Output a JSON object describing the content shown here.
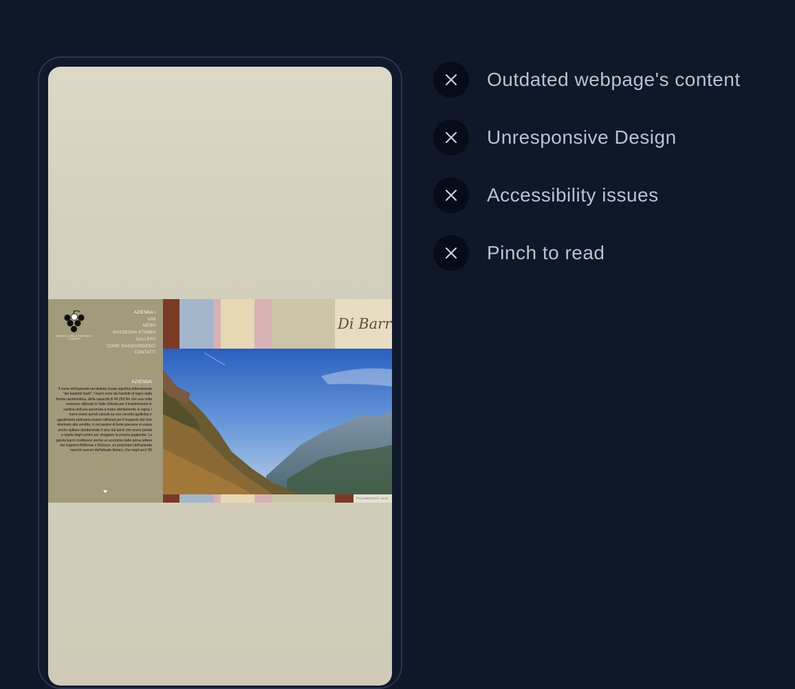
{
  "issues": [
    {
      "label": "Outdated webpage's content",
      "icon": "close-icon"
    },
    {
      "label": "Unresponsive Design",
      "icon": "close-icon"
    },
    {
      "label": "Accessibility issues",
      "icon": "close-icon"
    },
    {
      "label": "Pinch to read",
      "icon": "close-icon"
    }
  ],
  "site": {
    "brand_line1": "TERRES DOUBLE PROPRIETE",
    "brand_line2": "DI BARRÒ",
    "menu": [
      {
        "label": "AZIENDA",
        "active": true
      },
      {
        "label": "VINI",
        "active": false
      },
      {
        "label": "NEWS",
        "active": false
      },
      {
        "label": "RASSEGNA STAMPA",
        "active": false
      },
      {
        "label": "GALLERY",
        "active": false
      },
      {
        "label": "COME RAGGIUNGERCI",
        "active": false
      },
      {
        "label": "CONTATTI",
        "active": false
      }
    ],
    "section_title": "AZIENDA",
    "body": "Il nome dell'azienda nel dialetto locale significa letteralmente \"dei barilotti/ barili\". I barrò sono dei barilotti di legno dalla forma caratteristica, della capacità di 46,250 litri che una volta venivano utilizzati in Valle d'Aosta per il trasferimento in cantina dell'uva spremuta a mano direttamente in vigna; i barrò erano quindi caricati su una carretta (galliolla) e ugualmente potevano essere utilizzati per il trasporto del vino destinato alla vendita; in occasione di feste paesane si usava anche spillare direttamente il vino dai barrò che erano portati a spalla dagli uomini per sfoggiare la propria gagliardia. La parola barrò costituisce anche un acronimo delle prime lettere dei cognomi BARmaz e ROsson, ex proprietari dell'azienda nonché suoceri dell'attuale titolare, che negli anni '60",
    "logo_text": "Di Barrò",
    "footer_text": "P.IVA 00863370073 · info@",
    "colors": {
      "sidebar": "#a19b7c",
      "stripe_brown": "#7a3a26",
      "stripe_blue": "#a4b6cc",
      "stripe_pink": "#d8b2b3",
      "stripe_cream": "#e6d8b4",
      "stripe_khaki": "#cbc4a6",
      "logo_bg": "#e8ddc0"
    }
  }
}
